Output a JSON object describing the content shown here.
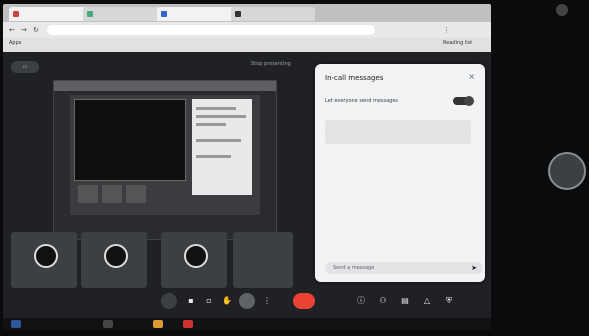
{
  "browser": {
    "tabs": [
      {
        "label": "",
        "color": "#c44"
      },
      {
        "label": "",
        "color": "#4a7"
      },
      {
        "label": "",
        "color": "#36c"
      },
      {
        "label": "",
        "color": "#333"
      }
    ],
    "address": "",
    "bookmarks": [
      {
        "label": "Apps"
      },
      {
        "label": ""
      },
      {
        "label": ""
      },
      {
        "label": ""
      },
      {
        "label": ""
      },
      {
        "label": ""
      },
      {
        "label": ""
      },
      {
        "label": "Reading list"
      }
    ]
  },
  "meet": {
    "presenting_text": "",
    "stop_label": "Stop presenting",
    "tiles": [
      {
        "name": ""
      },
      {
        "name": ""
      },
      {
        "name": ""
      },
      {
        "name": ""
      }
    ],
    "time": "",
    "end_call_color": "#ea4335"
  },
  "panel": {
    "title": "In-call messages",
    "close": "×",
    "toggle_label": "Let everyone send messages",
    "info": "",
    "messages": [
      {
        "name": "",
        "body": ""
      },
      {
        "name": "",
        "body": ""
      },
      {
        "name": "",
        "body": ""
      }
    ],
    "send_placeholder": "Send a message",
    "send_icon": "➤"
  },
  "right": {
    "name": ""
  }
}
